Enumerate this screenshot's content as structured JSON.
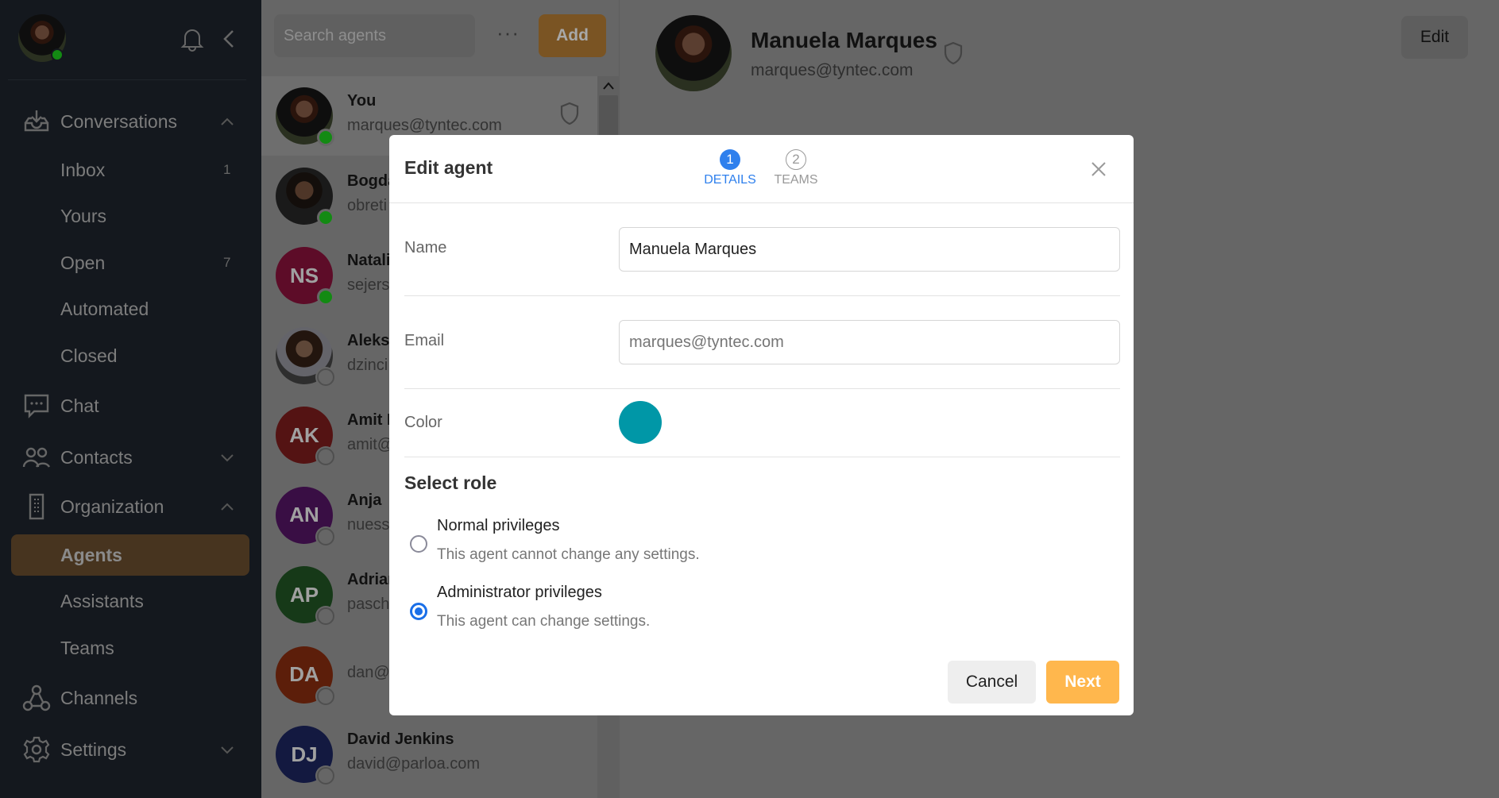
{
  "sidebar": {
    "items": [
      {
        "label": "Conversations",
        "icon": "inbox-icon",
        "expanded": true
      },
      {
        "label": "Inbox",
        "count": "1"
      },
      {
        "label": "Yours"
      },
      {
        "label": "Open",
        "count": "7"
      },
      {
        "label": "Automated"
      },
      {
        "label": "Closed"
      },
      {
        "label": "Chat",
        "icon": "chat-icon"
      },
      {
        "label": "Contacts",
        "icon": "contacts-icon",
        "expanded": false
      },
      {
        "label": "Organization",
        "icon": "building-icon",
        "expanded": true
      },
      {
        "label": "Agents",
        "active": true
      },
      {
        "label": "Assistants"
      },
      {
        "label": "Teams"
      },
      {
        "label": "Channels",
        "icon": "channels-icon"
      },
      {
        "label": "Settings",
        "icon": "gear-icon",
        "expanded": false
      }
    ],
    "active_color": "#b3834e"
  },
  "agents_panel": {
    "search_placeholder": "Search agents",
    "add_label": "Add",
    "agents": [
      {
        "name": "You",
        "email": "marques@tyntec.com",
        "online": true,
        "admin": true
      },
      {
        "name": "Bogda",
        "email": "obreti",
        "online": true
      },
      {
        "name": "Natali",
        "email": "sejers",
        "initials": "NS",
        "color": "#e91e63",
        "online": true
      },
      {
        "name": "Aleks",
        "email": "dzinci",
        "online": false
      },
      {
        "name": "Amit I",
        "email": "amit@",
        "initials": "AK",
        "color": "#d32f2f",
        "online": false
      },
      {
        "name": "Anja",
        "email": "nuess",
        "initials": "AN",
        "color": "#8e24aa",
        "online": false
      },
      {
        "name": "Adrian",
        "email": "pasch",
        "initials": "AP",
        "color": "#388e3c",
        "online": false
      },
      {
        "name": "",
        "email": "dan@",
        "initials": "DA",
        "color": "#e64a19",
        "online": false
      },
      {
        "name": "David Jenkins",
        "email": "david@parloa.com",
        "initials": "DJ",
        "color": "#303f9f",
        "online": false
      }
    ]
  },
  "detail": {
    "name": "Manuela Marques",
    "email": "marques@tyntec.com",
    "edit_label": "Edit"
  },
  "modal": {
    "title": "Edit agent",
    "steps": [
      {
        "num": "1",
        "label": "DETAILS",
        "active": true
      },
      {
        "num": "2",
        "label": "TEAMS",
        "active": false
      }
    ],
    "name_label": "Name",
    "name_value": "Manuela Marques",
    "email_label": "Email",
    "email_placeholder": "marques@tyntec.com",
    "color_label": "Color",
    "color_value": "#0097a7",
    "role_heading": "Select role",
    "roles": [
      {
        "title": "Normal privileges",
        "desc": "This agent cannot change any settings.",
        "selected": false
      },
      {
        "title": "Administrator privileges",
        "desc": "This agent can change settings.",
        "selected": true
      }
    ],
    "cancel_label": "Cancel",
    "next_label": "Next",
    "accent": "#1a6fe8",
    "next_color": "#ffb74d"
  }
}
